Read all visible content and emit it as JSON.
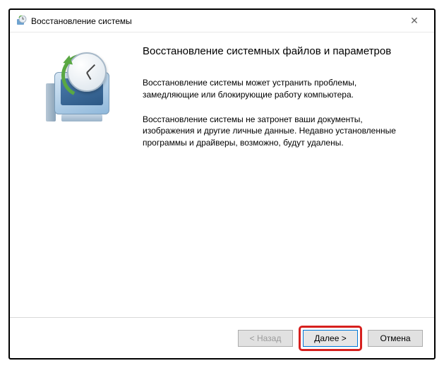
{
  "window": {
    "title": "Восстановление системы",
    "close_symbol": "✕"
  },
  "main": {
    "heading": "Восстановление системных файлов и параметров",
    "paragraph1": "Восстановление системы может устранить проблемы, замедляющие или блокирующие работу компьютера.",
    "paragraph2": "Восстановление системы не затронет ваши документы, изображения и другие личные данные. Недавно установленные программы и драйверы, возможно, будут удалены."
  },
  "buttons": {
    "back": "< Назад",
    "next": "Далее >",
    "cancel": "Отмена"
  }
}
